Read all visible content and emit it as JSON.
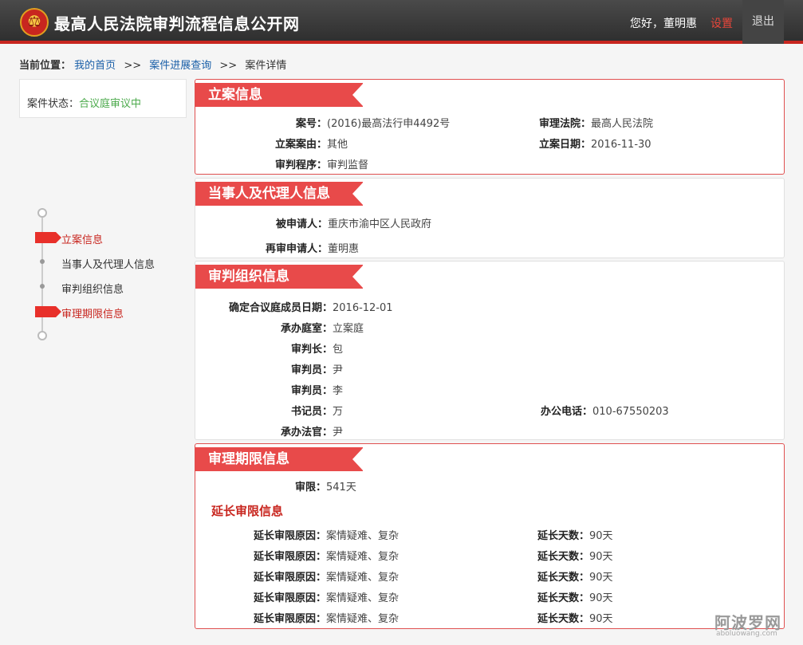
{
  "header": {
    "site_title": "最高人民法院审判流程信息公开网",
    "greeting": "您好，董明惠",
    "settings": "设置",
    "logout": "退出"
  },
  "breadcrumb": {
    "prefix": "当前位置：",
    "home": "我的首页",
    "sep1": ">>",
    "progress": "案件进展查询",
    "sep2": ">>",
    "current": "案件详情"
  },
  "status": {
    "label": "案件状态：",
    "value": "合议庭审议中"
  },
  "nav": {
    "items": [
      {
        "label": "立案信息",
        "active": true
      },
      {
        "label": "当事人及代理人信息",
        "active": false
      },
      {
        "label": "审判组织信息",
        "active": false
      },
      {
        "label": "审理期限信息",
        "active": true
      }
    ]
  },
  "filing": {
    "title": "立案信息",
    "case_no_label": "案号：",
    "case_no": "(2016)最高法行申4492号",
    "court_label": "审理法院：",
    "court": "最高人民法院",
    "cause_label": "立案案由：",
    "cause": "其他",
    "date_label": "立案日期：",
    "date": "2016-11-30",
    "procedure_label": "审判程序：",
    "procedure": "审判监督"
  },
  "parties": {
    "title": "当事人及代理人信息",
    "respondent_label": "被申请人：",
    "respondent": "重庆市渝中区人民政府",
    "applicant_label": "再审申请人：",
    "applicant": "董明惠"
  },
  "organization": {
    "title": "审判组织信息",
    "panel_date_label": "确定合议庭成员日期：",
    "panel_date": "2016-12-01",
    "division_label": "承办庭室：",
    "division": "立案庭",
    "chief_label": "审判长：",
    "chief": "包",
    "judge1_label": "审判员：",
    "judge1": "尹",
    "judge2_label": "审判员：",
    "judge2": "李",
    "clerk_label": "书记员：",
    "clerk": "万",
    "phone_label": "办公电话：",
    "phone": "010-67550203",
    "handler_label": "承办法官：",
    "handler": "尹"
  },
  "term": {
    "title": "审理期限信息",
    "limit_label": "审限：",
    "limit": "541天",
    "ext_title": "延长审限信息",
    "extensions": [
      {
        "reason_label": "延长审限原因：",
        "reason": "案情疑难、复杂",
        "days_label": "延长天数：",
        "days": "90天"
      },
      {
        "reason_label": "延长审限原因：",
        "reason": "案情疑难、复杂",
        "days_label": "延长天数：",
        "days": "90天"
      },
      {
        "reason_label": "延长审限原因：",
        "reason": "案情疑难、复杂",
        "days_label": "延长天数：",
        "days": "90天"
      },
      {
        "reason_label": "延长审限原因：",
        "reason": "案情疑难、复杂",
        "days_label": "延长天数：",
        "days": "90天"
      },
      {
        "reason_label": "延长审限原因：",
        "reason": "案情疑难、复杂",
        "days_label": "延长天数：",
        "days": "90天"
      }
    ]
  },
  "watermark": {
    "cn": "阿波罗网",
    "en": "aboluowang.com"
  },
  "colors": {
    "accent": "#e84a4a",
    "status_green": "#4caa4c",
    "link_blue": "#1a5fa8"
  }
}
